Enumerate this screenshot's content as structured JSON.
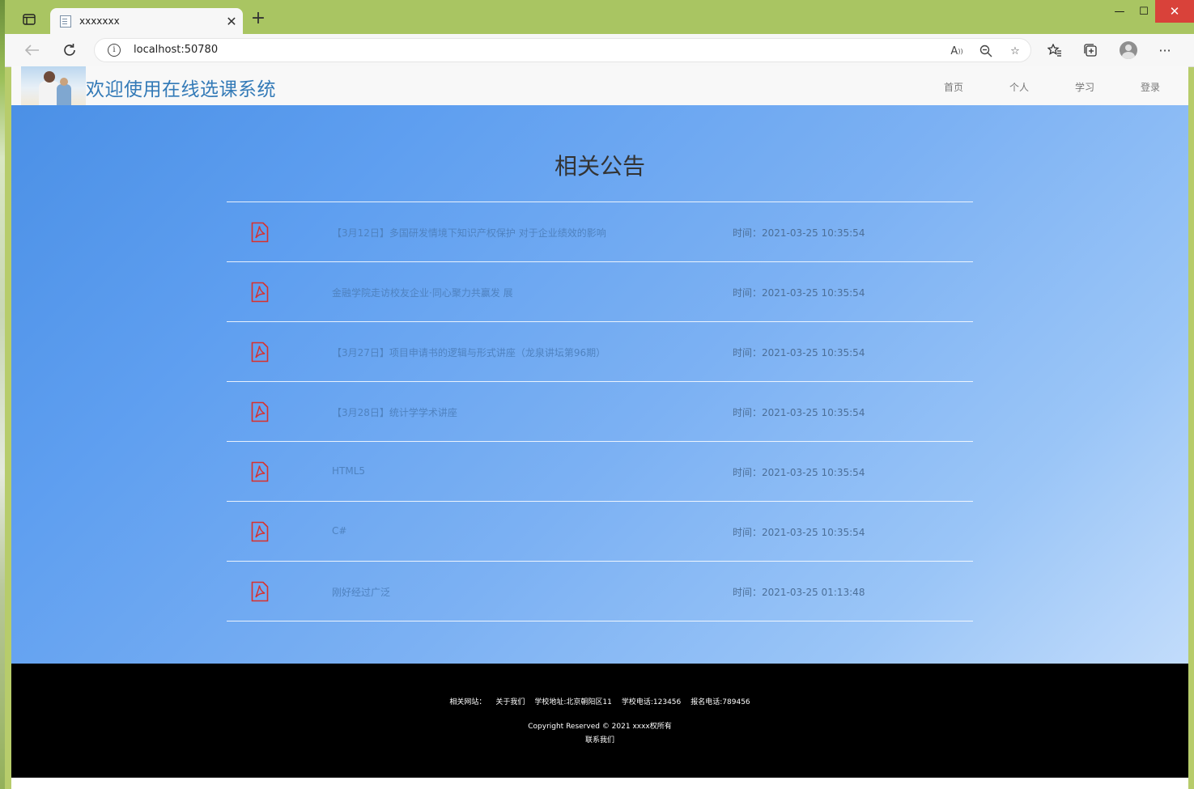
{
  "browser": {
    "tab_title": "xxxxxxx",
    "url": "localhost:50780"
  },
  "site": {
    "title": "欢迎使用在线选课系统",
    "nav": [
      "首页",
      "个人",
      "学习",
      "登录"
    ]
  },
  "notices": {
    "heading": "相关公告",
    "items": [
      {
        "title": "【3月12日】多国研发情境下知识产权保护 对于企业绩效的影响",
        "time": "时间：2021-03-25 10:35:54"
      },
      {
        "title": "金融学院走访校友企业·同心聚力共赢发 展",
        "time": "时间：2021-03-25 10:35:54"
      },
      {
        "title": "【3月27日】项目申请书的逻辑与形式讲座（龙泉讲坛第96期）",
        "time": "时间：2021-03-25 10:35:54"
      },
      {
        "title": "【3月28日】统计学学术讲座",
        "time": "时间：2021-03-25 10:35:54"
      },
      {
        "title": "HTML5",
        "time": "时间：2021-03-25 10:35:54"
      },
      {
        "title": "C#",
        "time": "时间：2021-03-25 10:35:54"
      },
      {
        "title": "刚好经过广泛",
        "time": "时间：2021-03-25 01:13:48"
      }
    ]
  },
  "footer": {
    "links": [
      "相关网站：",
      "关于我们",
      "学校地址:北京朝阳区11",
      "学校电话:123456",
      "报名电话:789456"
    ],
    "copyright": "Copyright Reserved © 2021 xxxx权所有",
    "contact": "联系我们"
  },
  "colors": {
    "site_title": "#337ab7",
    "pdf_icon": "#d9302c",
    "footer_bg": "#000000",
    "close_button": "#d9423a"
  }
}
